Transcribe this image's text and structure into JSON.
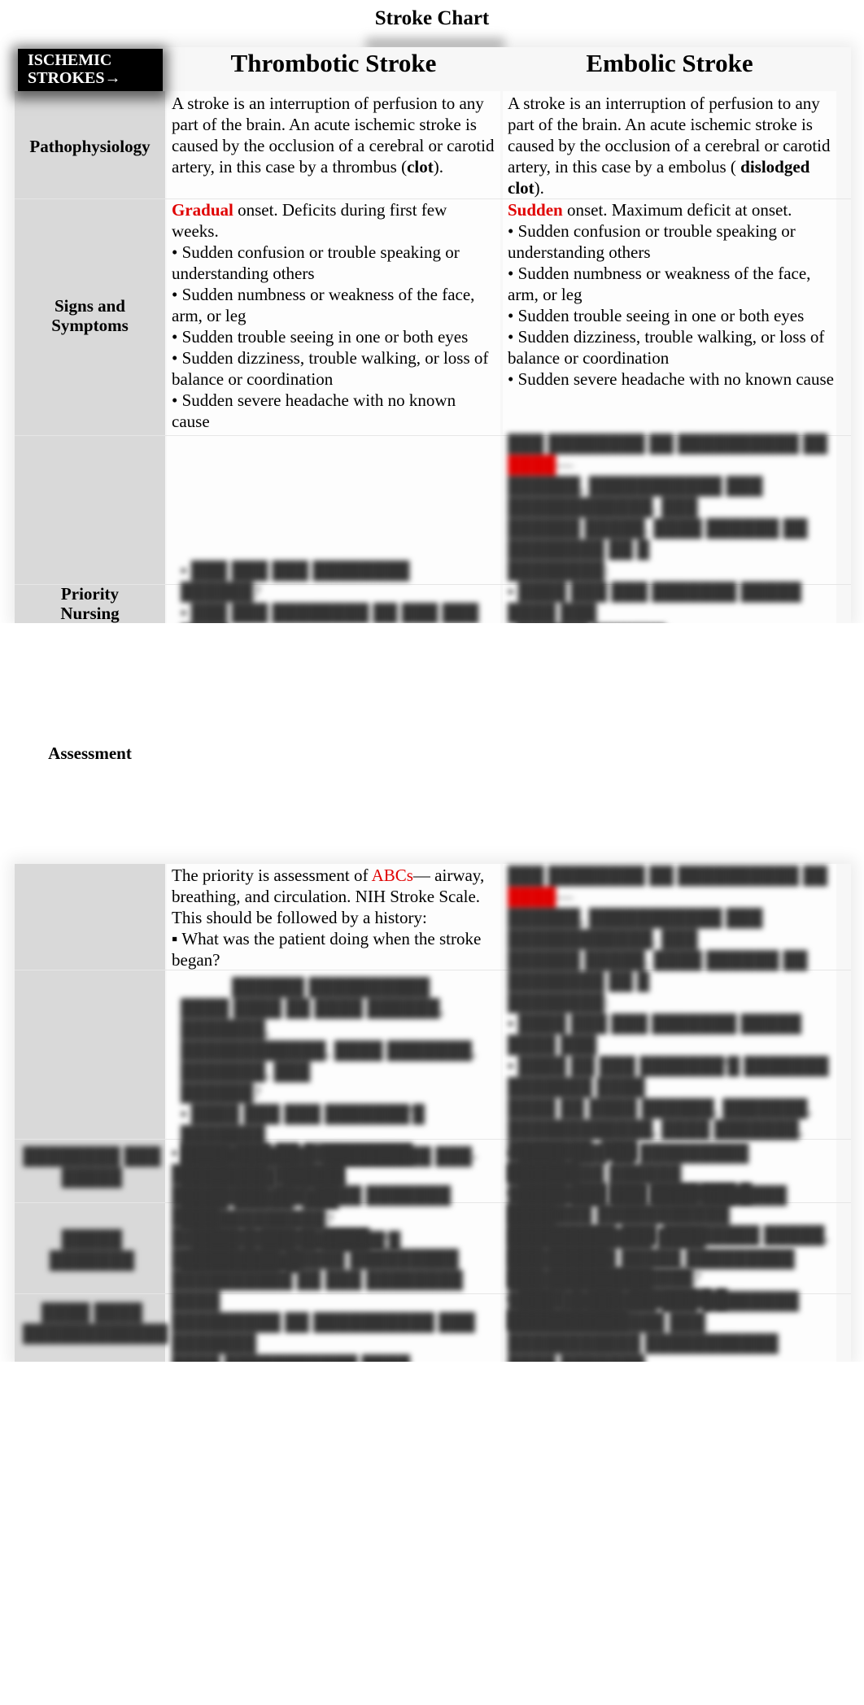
{
  "document": {
    "title": "Stroke Chart",
    "corner_header": [
      "ISCHEMIC",
      "STROKES→"
    ],
    "columns": [
      "Thrombotic Stroke",
      "Embolic Stroke"
    ],
    "rows": {
      "pathophysiology": {
        "label": "Pathophysiology",
        "thrombotic": {
          "text": "A stroke is an interruption of perfusion to any part of the brain. An acute ischemic stroke is caused by the occlusion of a cerebral or carotid artery, in this case by a thrombus (",
          "bold": "clot",
          "end": ")."
        },
        "embolic": {
          "text": "A stroke is an interruption of perfusion to any part of the brain. An acute ischemic stroke is caused by the occlusion of a cerebral or carotid artery, in this case by a embolus ( ",
          "bold": "dislodged clot",
          "end": ")."
        }
      },
      "signs": {
        "label_lines": [
          "Signs and",
          "Symptoms"
        ],
        "thrombotic": {
          "onset_keyword": "Gradual",
          "onset_rest": " onset. Deficits during first few weeks.",
          "bullets": [
            "• Sudden confusion or trouble speaking or understanding others",
            "• Sudden numbness or weakness of the face, arm, or leg",
            "• Sudden trouble seeing in one or both eyes",
            "• Sudden dizziness, trouble walking, or loss of balance or coordination",
            "• Sudden severe headache with no known cause"
          ]
        },
        "embolic": {
          "onset_keyword": "Sudden",
          "onset_rest": " onset. Maximum deficit at onset.",
          "bullets": [
            "• Sudden confusion or trouble speaking or understanding others",
            "• Sudden numbness or weakness of the face, arm, or leg",
            "• Sudden trouble seeing in one or both eyes",
            "• Sudden dizziness, trouble walking, or loss of balance or coordination",
            "• Sudden severe headache with no known cause"
          ]
        }
      },
      "assessment": {
        "label_lines": [
          "Priority",
          "Nursing"
        ],
        "label_continued": "Assessment",
        "thrombotic": {
          "intro": "The priority is assessment of ",
          "keyword": "ABCs",
          "rest": "— airway, breathing, and circulation.  NIH Stroke Scale. This should be followed by a history:",
          "bullet": "▪ What was the patient doing when the stroke began?"
        }
      }
    }
  }
}
